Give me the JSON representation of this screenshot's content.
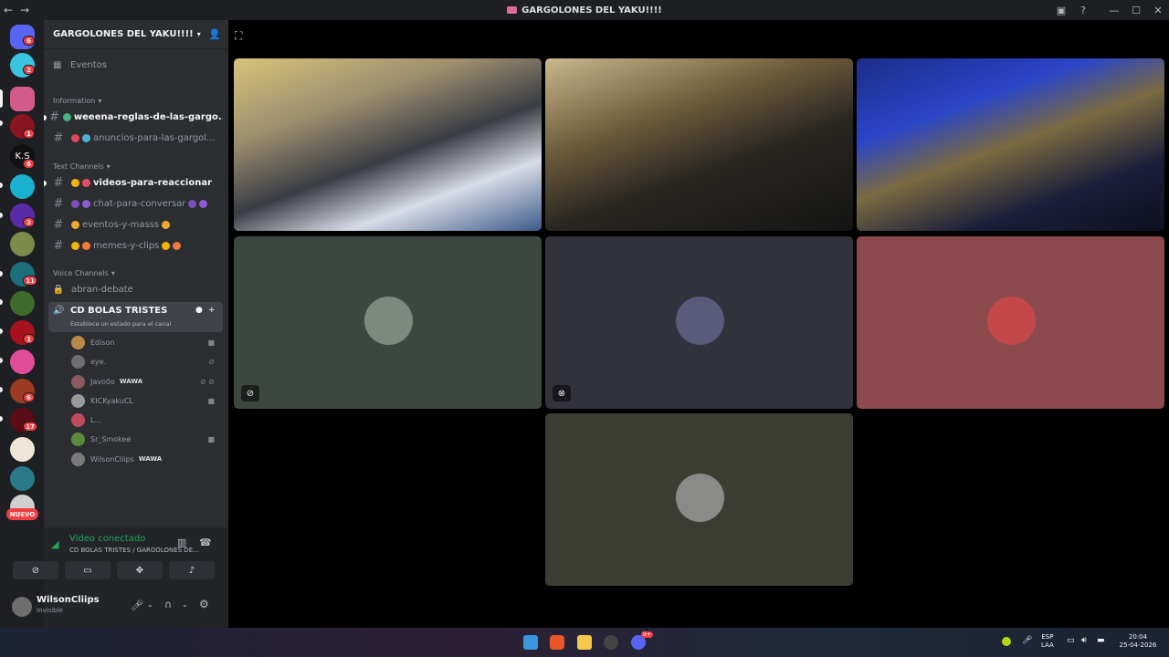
{
  "window": {
    "title": "GARGOLONES DEL YAKU!!!!"
  },
  "guilds": {
    "items": [
      {
        "badge": "6"
      },
      {
        "badge": "2"
      },
      {
        "badge": ""
      },
      {
        "badge": "1"
      },
      {
        "badge": "6",
        "text": "K.S"
      },
      {
        "badge": ""
      },
      {
        "badge": "3"
      },
      {
        "badge": ""
      },
      {
        "badge": "11"
      },
      {
        "badge": ""
      },
      {
        "badge": "1"
      },
      {
        "badge": ""
      },
      {
        "badge": "6"
      },
      {
        "badge": "17"
      },
      {
        "badge": ""
      },
      {
        "badge": ""
      }
    ],
    "new_label": "NUEVO"
  },
  "server": {
    "name": "GARGOLONES DEL YAKU!!!!",
    "events_label": "Eventos",
    "cat_information": "Information",
    "cat_text": "Text Channels",
    "cat_voice": "Voice Channels",
    "channels_info": [
      "weeena-reglas-de-las-gargo...",
      "anuncios-para-las-gargol..."
    ],
    "channels_text": [
      "videos-para-reaccionar",
      "chat-para-conversar",
      "eventos-y-masss",
      "memes-y-clips"
    ],
    "voice_channel_1": "abran-debate",
    "voice_channel_active": "CD BOLAS TRISTES",
    "voice_status_hint": "Establece un estado para el canal",
    "members": [
      {
        "name": "Edison",
        "tag": ""
      },
      {
        "name": "eye.",
        "tag": ""
      },
      {
        "name": "Javo0o",
        "tag": "WAWA"
      },
      {
        "name": "KICKyakuCL",
        "tag": ""
      },
      {
        "name": "L...",
        "tag": ""
      },
      {
        "name": "Sr_Smokee",
        "tag": ""
      },
      {
        "name": "WilsonCliips",
        "tag": "WAWA"
      }
    ]
  },
  "voice_connection": {
    "status": "Video conectado",
    "location": "CD BOLAS TRISTES / GARGOLONES DE..."
  },
  "user": {
    "name": "WilsonCliips",
    "status": "Invisible"
  },
  "taskbar": {
    "lang": "ESP",
    "lang2": "LAA",
    "time": "20:04",
    "date": "25-04-2026",
    "discord_badge": "9+"
  },
  "colors": {
    "accent": "#5865f2",
    "connected": "#23a55a",
    "danger": "#f23f43"
  }
}
